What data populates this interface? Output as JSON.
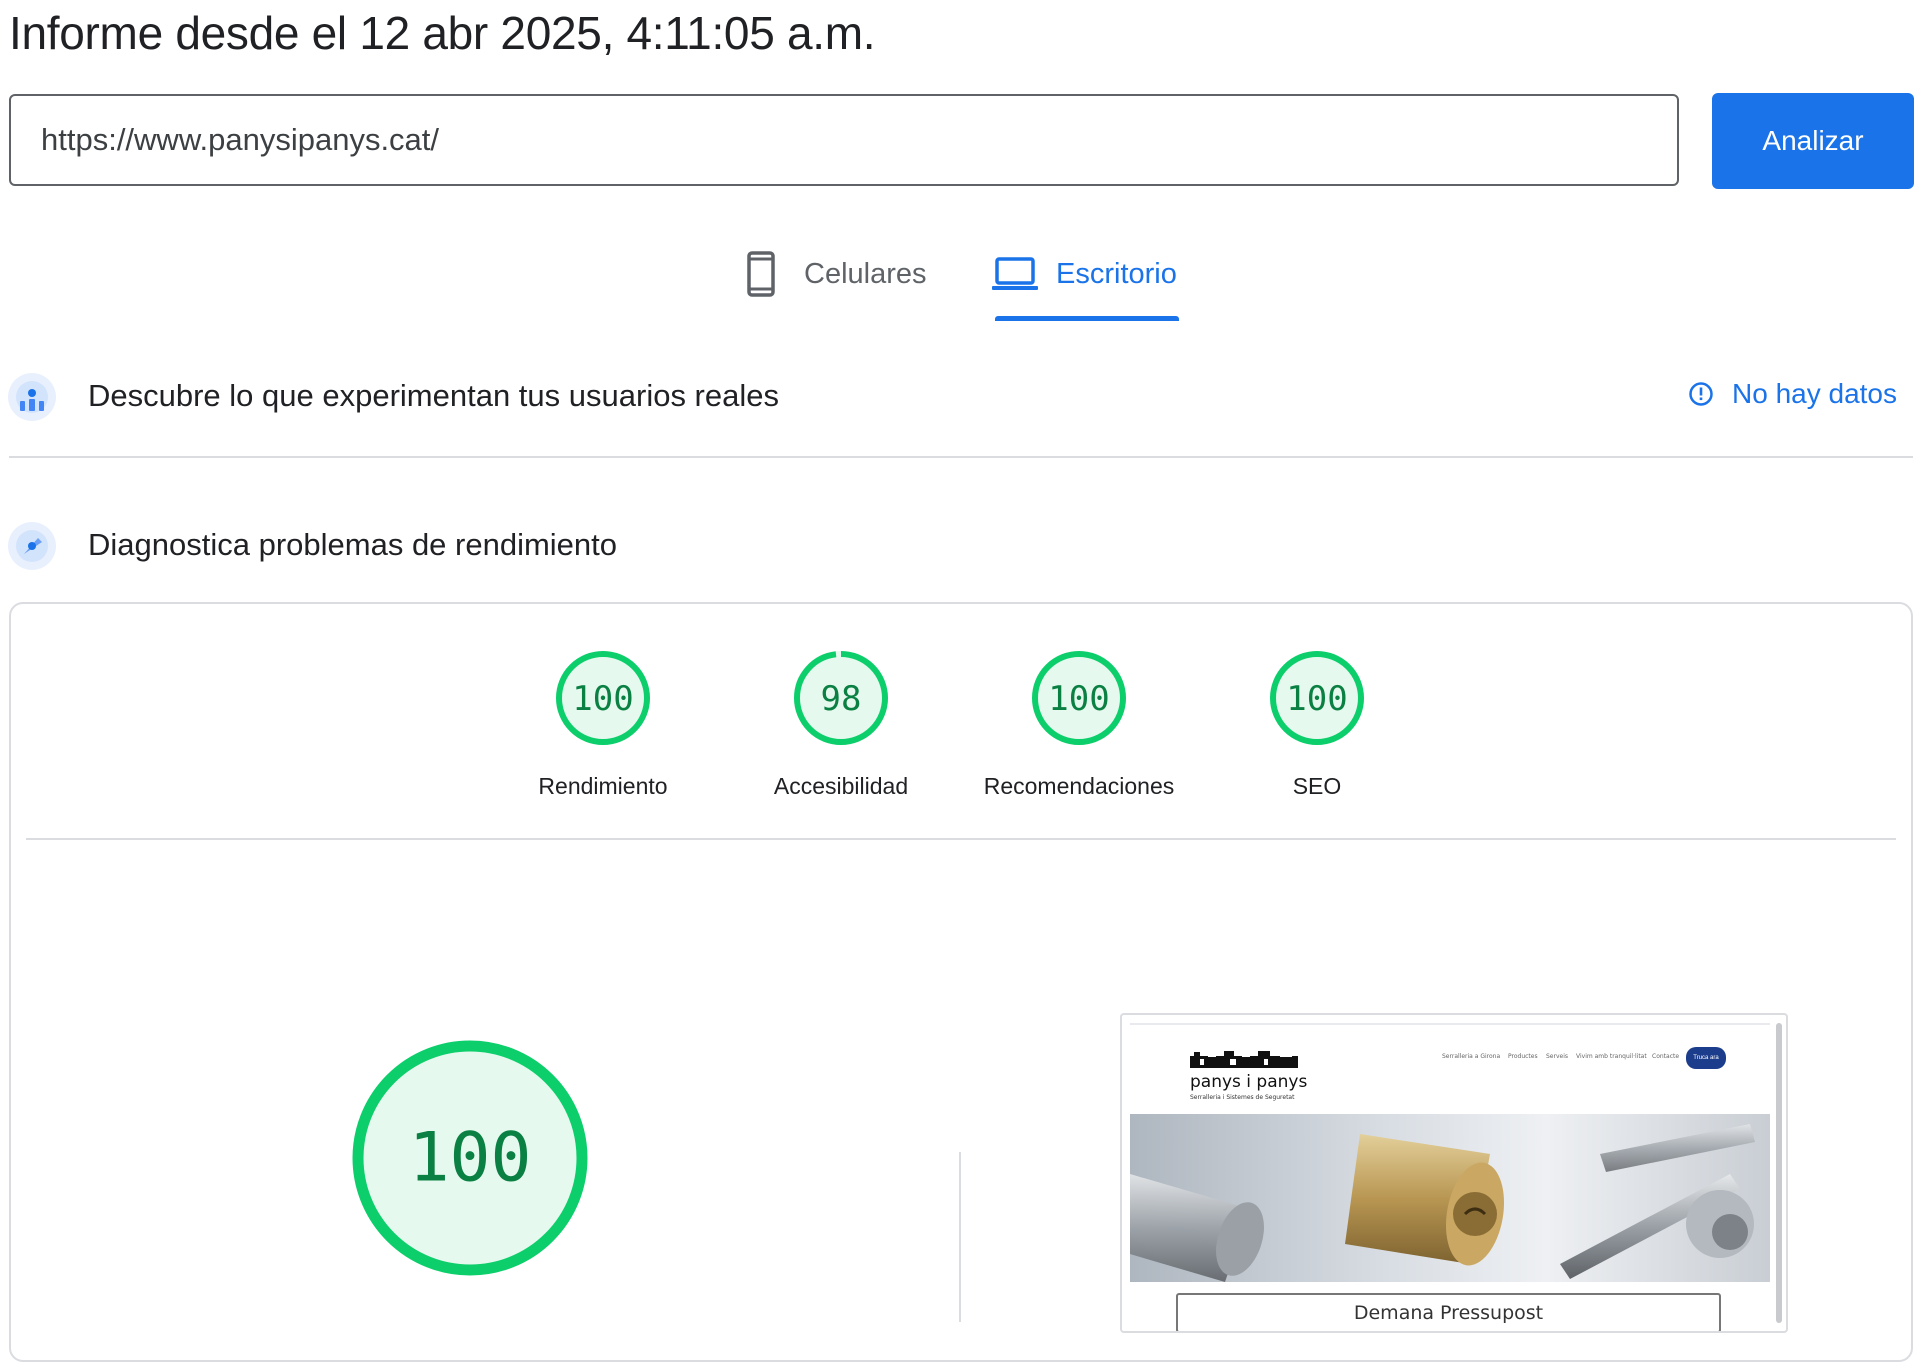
{
  "header": {
    "title": "Informe desde el 12 abr 2025, 4:11:05 a.m."
  },
  "search": {
    "value": "https://www.panysipanys.cat/",
    "button_label": "Analizar"
  },
  "tabs": [
    {
      "label": "Celulares",
      "icon": "phone-icon",
      "active": false
    },
    {
      "label": "Escritorio",
      "icon": "laptop-icon",
      "active": true
    }
  ],
  "field_data": {
    "title": "Descubre lo que experimentan tus usuarios reales",
    "status": "No hay datos",
    "icon": "users-chart-icon",
    "status_icon": "info-icon"
  },
  "lab_data": {
    "title": "Diagnostica problemas de rendimiento",
    "icon": "compass-icon"
  },
  "scores": [
    {
      "label": "Rendimiento",
      "value": 100
    },
    {
      "label": "Accesibilidad",
      "value": 98
    },
    {
      "label": "Recomendaciones",
      "value": 100
    },
    {
      "label": "SEO",
      "value": 100
    }
  ],
  "main_score": {
    "value": 100
  },
  "colors": {
    "accent": "#1a73e8",
    "pass_ring": "#0cce6b",
    "pass_fill": "#e6f9ee",
    "pass_text": "#0b8043"
  },
  "preview": {
    "brand_name": "panys i panys",
    "brand_sub": "Serralleria i Sistemes de Seguretat",
    "nav": [
      "Serralleria a Girona",
      "Productes",
      "Serveis",
      "Vivim amb tranquil·litat",
      "Contacte"
    ],
    "nav_button": "Truca ara",
    "cta": "Demana Pressupost"
  }
}
